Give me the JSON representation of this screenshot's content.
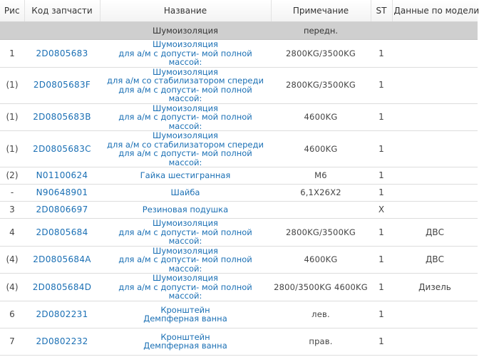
{
  "headers": {
    "ris": "Рис",
    "code": "Код запчасти",
    "name": "Название",
    "note": "Примечание",
    "st": "ST",
    "model": "Данные по модели"
  },
  "section": {
    "name": "Шумоизоляция",
    "note": "передн."
  },
  "rows": [
    {
      "ris": "1",
      "code": "2D0805683",
      "name": [
        "Шумоизоляция",
        "для а/м с допусти- мой полной массой:"
      ],
      "note": "2800KG/3500KG",
      "st": "1",
      "model": ""
    },
    {
      "ris": "(1)",
      "code": "2D0805683F",
      "name": [
        "Шумоизоляция",
        "для а/м со стабилизатором спереди",
        "для а/м с допусти- мой полной массой:"
      ],
      "note": "2800KG/3500KG",
      "st": "1",
      "model": ""
    },
    {
      "ris": "(1)",
      "code": "2D0805683B",
      "name": [
        "Шумоизоляция",
        "для а/м с допусти- мой полной массой:"
      ],
      "note": "4600KG",
      "st": "1",
      "model": ""
    },
    {
      "ris": "(1)",
      "code": "2D0805683C",
      "name": [
        "Шумоизоляция",
        "для а/м со стабилизатором спереди",
        "для а/м с допусти- мой полной массой:"
      ],
      "note": "4600KG",
      "st": "1",
      "model": ""
    },
    {
      "ris": "(2)",
      "code": "N01100624",
      "name": [
        "Гайка шестигранная"
      ],
      "note": "M6",
      "st": "1",
      "model": ""
    },
    {
      "ris": "-",
      "code": "N90648901",
      "name": [
        "Шайба"
      ],
      "note": "6,1X26X2",
      "st": "1",
      "model": ""
    },
    {
      "ris": "3",
      "code": "2D0806697",
      "name": [
        "Резиновая подушка"
      ],
      "note": "",
      "st": "X",
      "model": ""
    },
    {
      "ris": "4",
      "code": "2D0805684",
      "name": [
        "Шумоизоляция",
        "для а/м с допусти- мой полной массой:"
      ],
      "note": "2800KG/3500KG",
      "st": "1",
      "model": "ДВС"
    },
    {
      "ris": "(4)",
      "code": "2D0805684A",
      "name": [
        "Шумоизоляция",
        "для а/м с допусти- мой полной массой:"
      ],
      "note": "4600KG",
      "st": "1",
      "model": "ДВС"
    },
    {
      "ris": "(4)",
      "code": "2D0805684D",
      "name": [
        "Шумоизоляция",
        "для а/м с допусти- мой полной массой:"
      ],
      "note": "2800/3500KG 4600KG",
      "st": "1",
      "model": "Дизель"
    },
    {
      "ris": "6",
      "code": "2D0802231",
      "name": [
        "Кронштейн",
        "Демпферная ванна"
      ],
      "note": "лев.",
      "st": "1",
      "model": ""
    },
    {
      "ris": "7",
      "code": "2D0802232",
      "name": [
        "Кронштейн",
        "Демпферная ванна"
      ],
      "note": "прав.",
      "st": "1",
      "model": ""
    }
  ]
}
